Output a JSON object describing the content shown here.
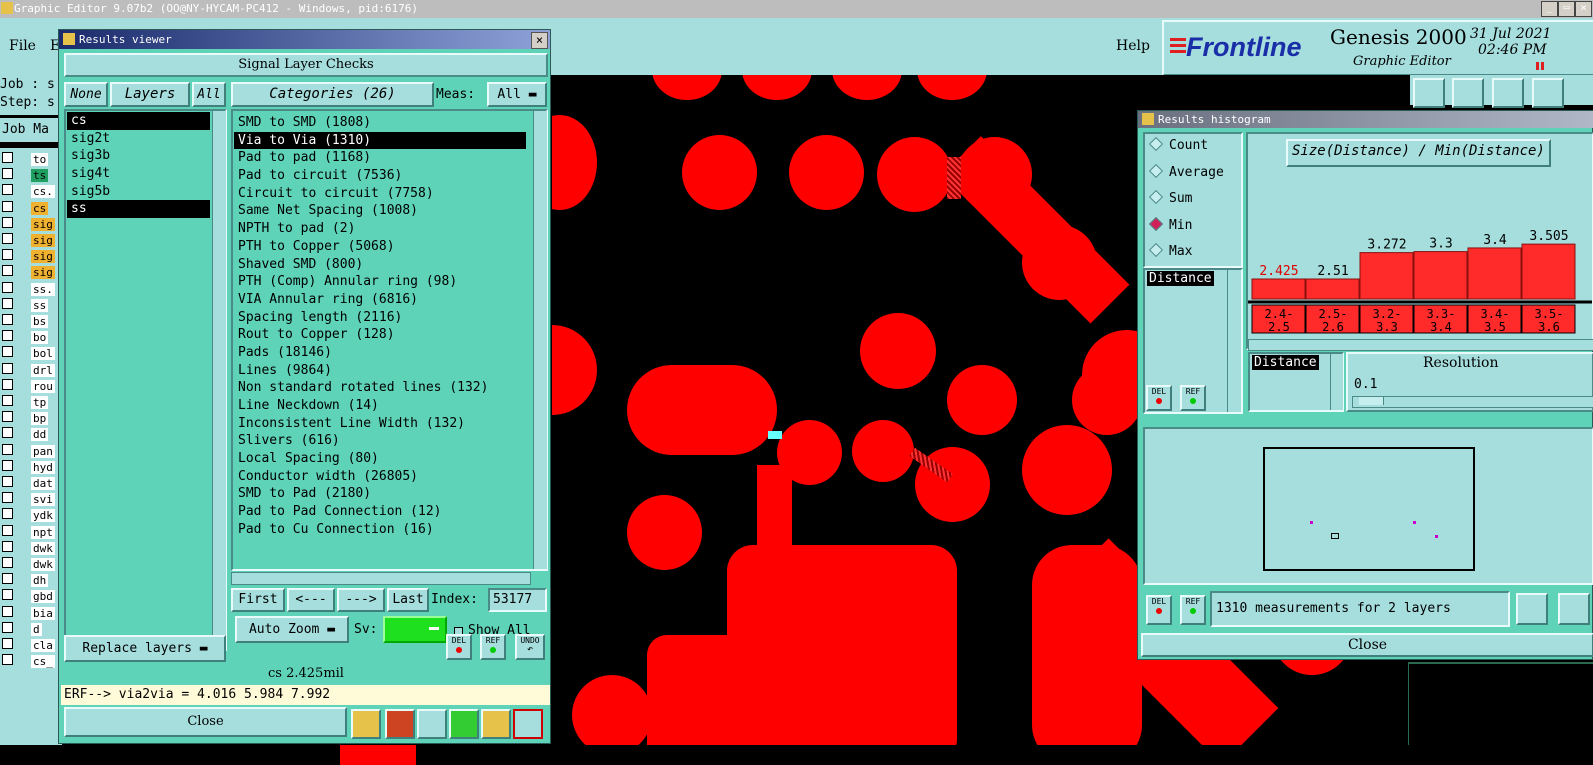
{
  "app": {
    "title": "Graphic Editor 9.07b2 (OO@NY-HYCAM-PC412 - Windows, pid:6176)",
    "menu": {
      "file": "File",
      "edit": "E",
      "help": "Help"
    },
    "brand": {
      "logo": "Frontline",
      "product": "Genesis 2000",
      "subtitle": "Graphic Editor",
      "date": "31 Jul 2021",
      "time": "02:46 PM"
    },
    "left_labels": {
      "job": "Job : s",
      "step": "Step: s",
      "job_matrix": "Job Ma"
    },
    "background_layers": [
      "to",
      "ts",
      "cs.",
      "cs",
      "sig",
      "sig",
      "sig",
      "sig",
      "ss.",
      "ss",
      "bs",
      "bo",
      "bol",
      "drl",
      "rou",
      "tp",
      "bp",
      "dd",
      "pan",
      "hyd",
      "dat",
      "svi",
      "ydk",
      "npt",
      "dwk",
      "dwk",
      "dh",
      "gbd",
      "bia",
      "d",
      "cla",
      "cs_"
    ]
  },
  "results_viewer": {
    "title": "Results viewer",
    "header": "Signal Layer Checks",
    "none_btn": "None",
    "layers_btn": "Layers",
    "all_btn": "All",
    "categories_btn": "Categories (26)",
    "meas_label": "Meas:",
    "meas_value": "All",
    "layers": [
      {
        "name": "cs",
        "selected": true
      },
      {
        "name": "sig2t",
        "selected": false
      },
      {
        "name": "sig3b",
        "selected": false
      },
      {
        "name": "sig4t",
        "selected": false
      },
      {
        "name": "sig5b",
        "selected": false
      },
      {
        "name": "ss",
        "selected": true
      }
    ],
    "categories": [
      {
        "label": "SMD to SMD (1808)",
        "selected": false
      },
      {
        "label": "Via to Via (1310)",
        "selected": true
      },
      {
        "label": "Pad to pad (1168)",
        "selected": false
      },
      {
        "label": "Pad to circuit (7536)",
        "selected": false
      },
      {
        "label": "Circuit to circuit (7758)",
        "selected": false
      },
      {
        "label": "Same Net Spacing (1008)",
        "selected": false
      },
      {
        "label": "NPTH to pad (2)",
        "selected": false
      },
      {
        "label": "PTH to Copper (5068)",
        "selected": false
      },
      {
        "label": "Shaved SMD (800)",
        "selected": false
      },
      {
        "label": "PTH (Comp) Annular ring (98)",
        "selected": false
      },
      {
        "label": "VIA Annular ring (6816)",
        "selected": false
      },
      {
        "label": "Spacing length (2116)",
        "selected": false
      },
      {
        "label": "Rout to Copper (128)",
        "selected": false
      },
      {
        "label": "Pads (18146)",
        "selected": false
      },
      {
        "label": "Lines (9864)",
        "selected": false
      },
      {
        "label": "Non standard rotated lines (132)",
        "selected": false
      },
      {
        "label": "Line Neckdown (14)",
        "selected": false
      },
      {
        "label": "Inconsistent Line Width (132)",
        "selected": false
      },
      {
        "label": "Slivers (616)",
        "selected": false
      },
      {
        "label": "Local Spacing (80)",
        "selected": false
      },
      {
        "label": "Conductor width (26805)",
        "selected": false
      },
      {
        "label": "SMD to Pad (2180)",
        "selected": false
      },
      {
        "label": "Pad to Pad Connection (12)",
        "selected": false
      },
      {
        "label": "Pad to Cu Connection (16)",
        "selected": false
      }
    ],
    "nav": {
      "first": "First",
      "prev": "<---",
      "next": "--->",
      "last": "Last",
      "index_label": "Index:",
      "index_value": "53177"
    },
    "auto_zoom": "Auto Zoom",
    "sv_label": "Sv:",
    "show_all": "Show All",
    "replace_layers": "Replace layers",
    "del": "DEL",
    "ref": "REF",
    "undo": "UNDO",
    "status": "cs 2.425mil",
    "erf": "ERF--> via2via = 4.016 5.984 7.992",
    "close": "Close"
  },
  "histogram": {
    "title": "Results histogram",
    "modes": [
      {
        "label": "Count",
        "selected": false
      },
      {
        "label": "Average",
        "selected": false
      },
      {
        "label": "Sum",
        "selected": false
      },
      {
        "label": "Min",
        "selected": true
      },
      {
        "label": "Max",
        "selected": false
      }
    ],
    "distance_item": "Distance",
    "chart_title": "Size(Distance) / Min(Distance)",
    "resolution_label": "Resolution",
    "resolution_value": "0.1",
    "summary": "1310 measurements for 2 layers",
    "del": "DEL",
    "ref": "REF",
    "close": "Close"
  },
  "chart_data": {
    "type": "bar",
    "title": "Size(Distance) / Min(Distance)",
    "categories": [
      "2.4-2.5",
      "2.5-2.6",
      "3.2-3.3",
      "3.3-3.4",
      "3.4-3.5",
      "3.5-3.6"
    ],
    "values": [
      2.425,
      2.51,
      3.272,
      3.3,
      3.4,
      3.505
    ],
    "value_labels": [
      "2.425",
      "2.51",
      "3.272",
      "3.3",
      "3.4",
      "3.505"
    ],
    "category_labels": [
      [
        "2.4-",
        "2.5"
      ],
      [
        "2.5-",
        "2.6"
      ],
      [
        "3.2-",
        "3.3"
      ],
      [
        "3.3-",
        "3.4"
      ],
      [
        "3.4-",
        "3.5"
      ],
      [
        "3.5-",
        "3.6"
      ]
    ],
    "colors": {
      "bar": "#ff2a2a",
      "highlight_label": "#e00000"
    }
  }
}
